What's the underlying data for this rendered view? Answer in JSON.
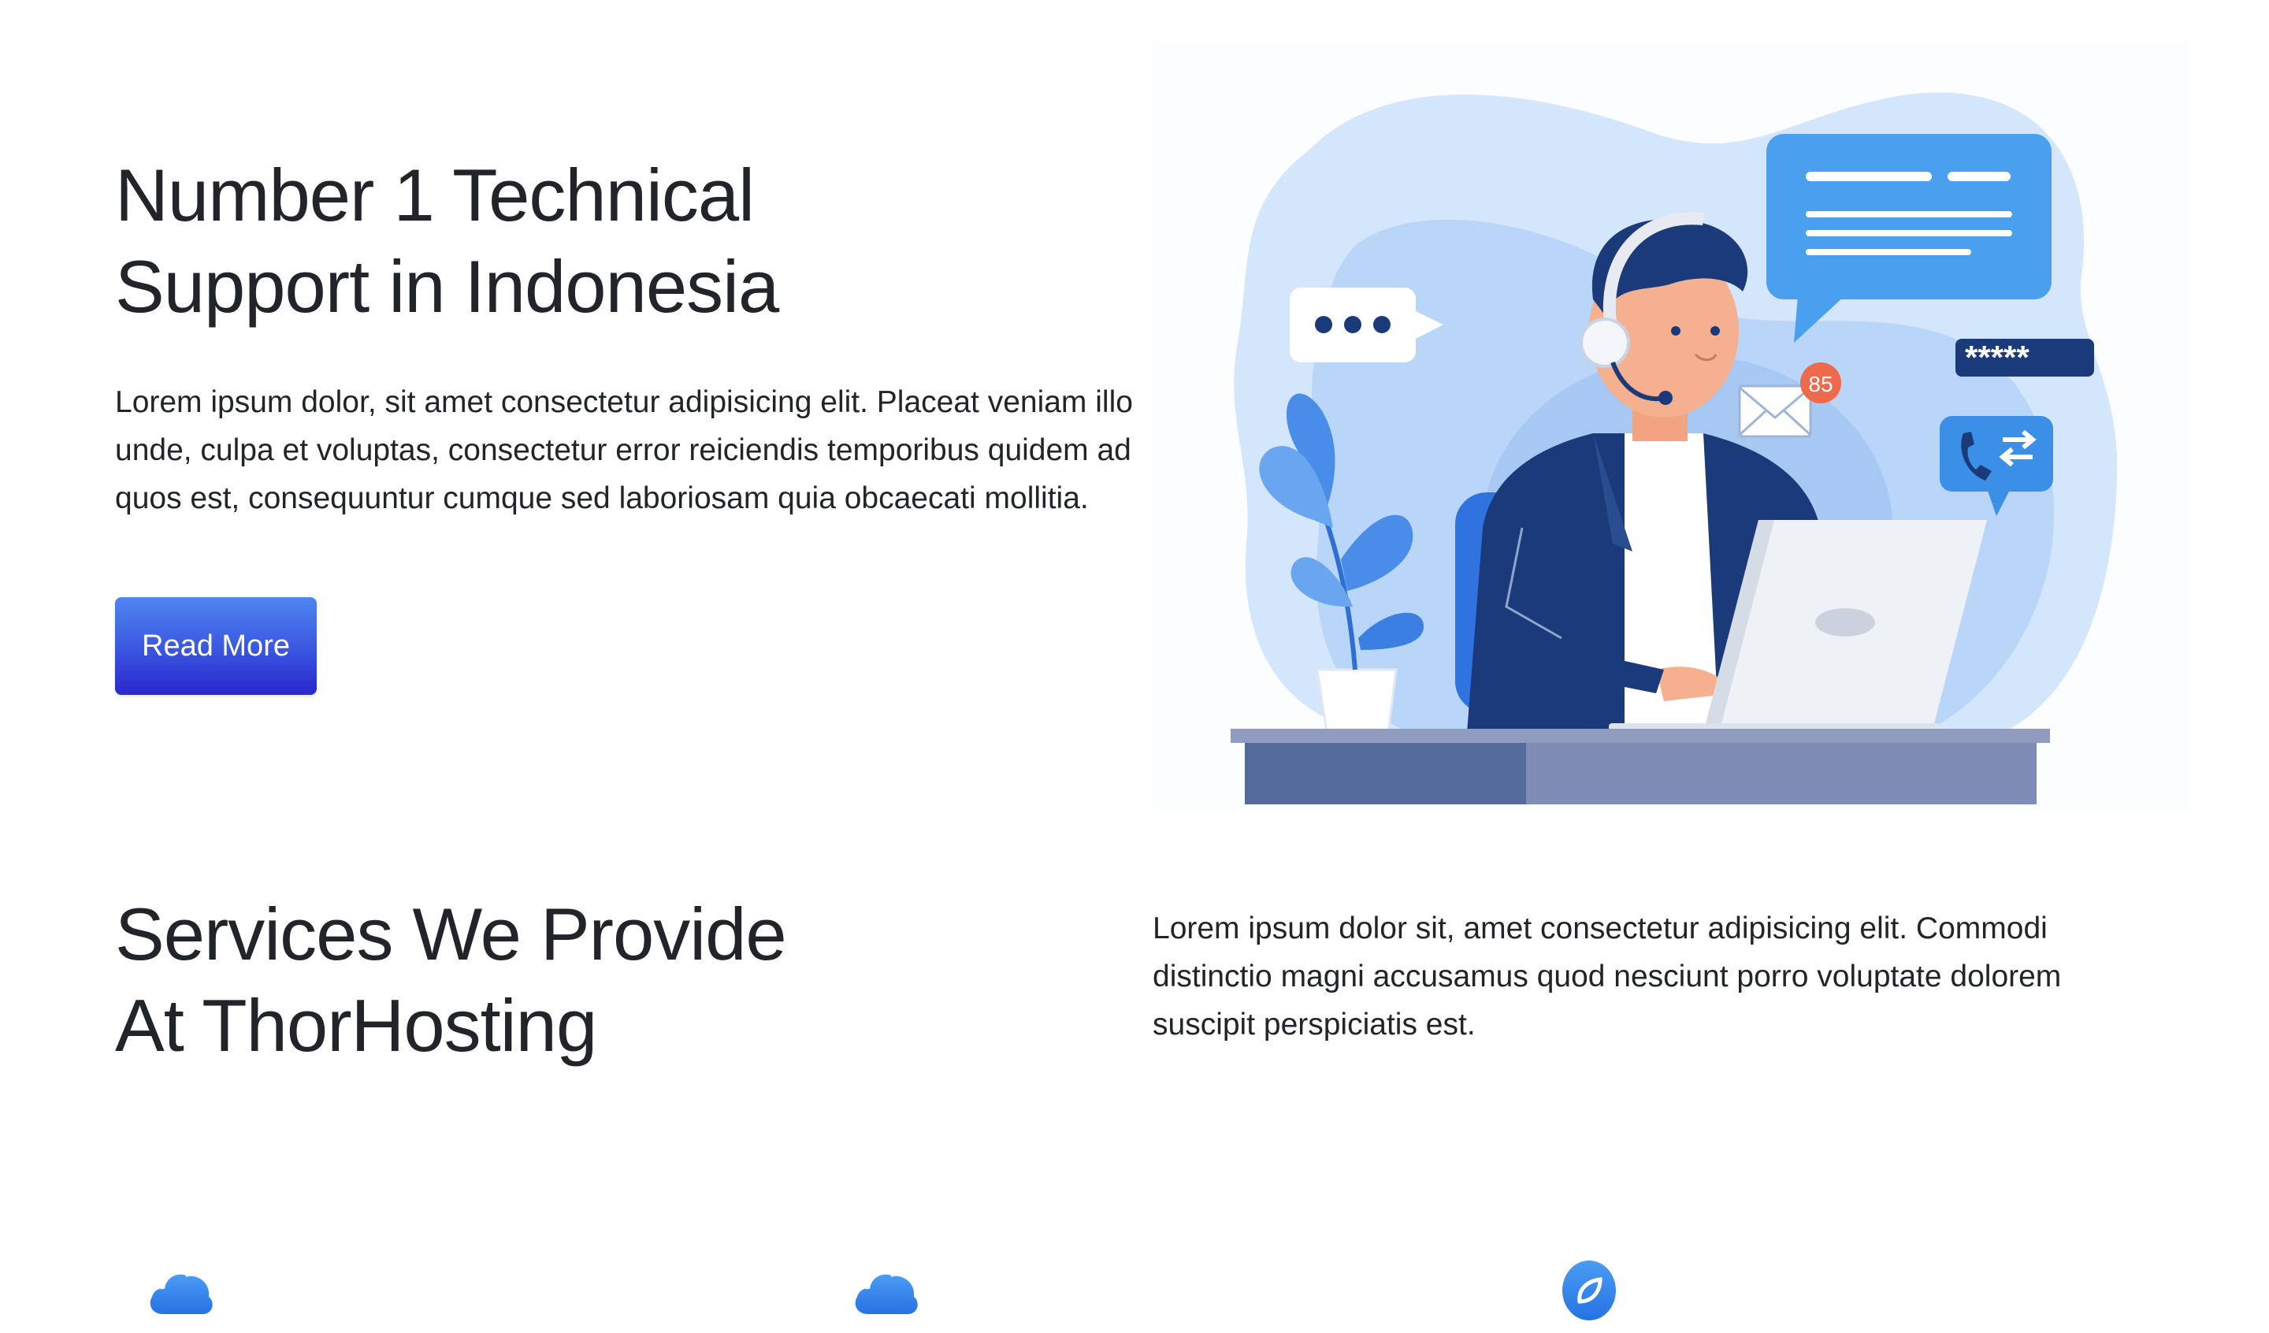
{
  "hero": {
    "title_line1": "Number 1 Technical",
    "title_line2": "Support in Indonesia",
    "description": "Lorem ipsum dolor, sit amet consectetur adipisicing elit. Placeat veniam illo unde, culpa et voluptas, consectetur error reiciendis temporibus quidem ad quos est, consequuntur cumque sed laboriosam quia obcaecati mollitia.",
    "button_label": "Read More",
    "illustration": {
      "icon": "customer-support-illustration",
      "mail_badge": "85",
      "password_mask": "*****"
    }
  },
  "services": {
    "title_line1": "Services We Provide",
    "title_line2": "At ThorHosting",
    "description": "Lorem ipsum dolor sit, amet consectetur adipisicing elit. Commodi distinctio magni accusamus quod nesciunt porro voluptate dolorem suscipit perspiciatis est.",
    "icons": [
      {
        "icon": "cloud-icon"
      },
      {
        "icon": "cloud-icon"
      },
      {
        "icon": "leaf-icon"
      }
    ]
  },
  "colors": {
    "button_gradient_start": "#4f86f2",
    "button_gradient_end": "#2a27cf",
    "icon_blue": "#2f80ed",
    "illustration_navy": "#1b3a7a",
    "illustration_light_blue": "#cfe3fb"
  }
}
